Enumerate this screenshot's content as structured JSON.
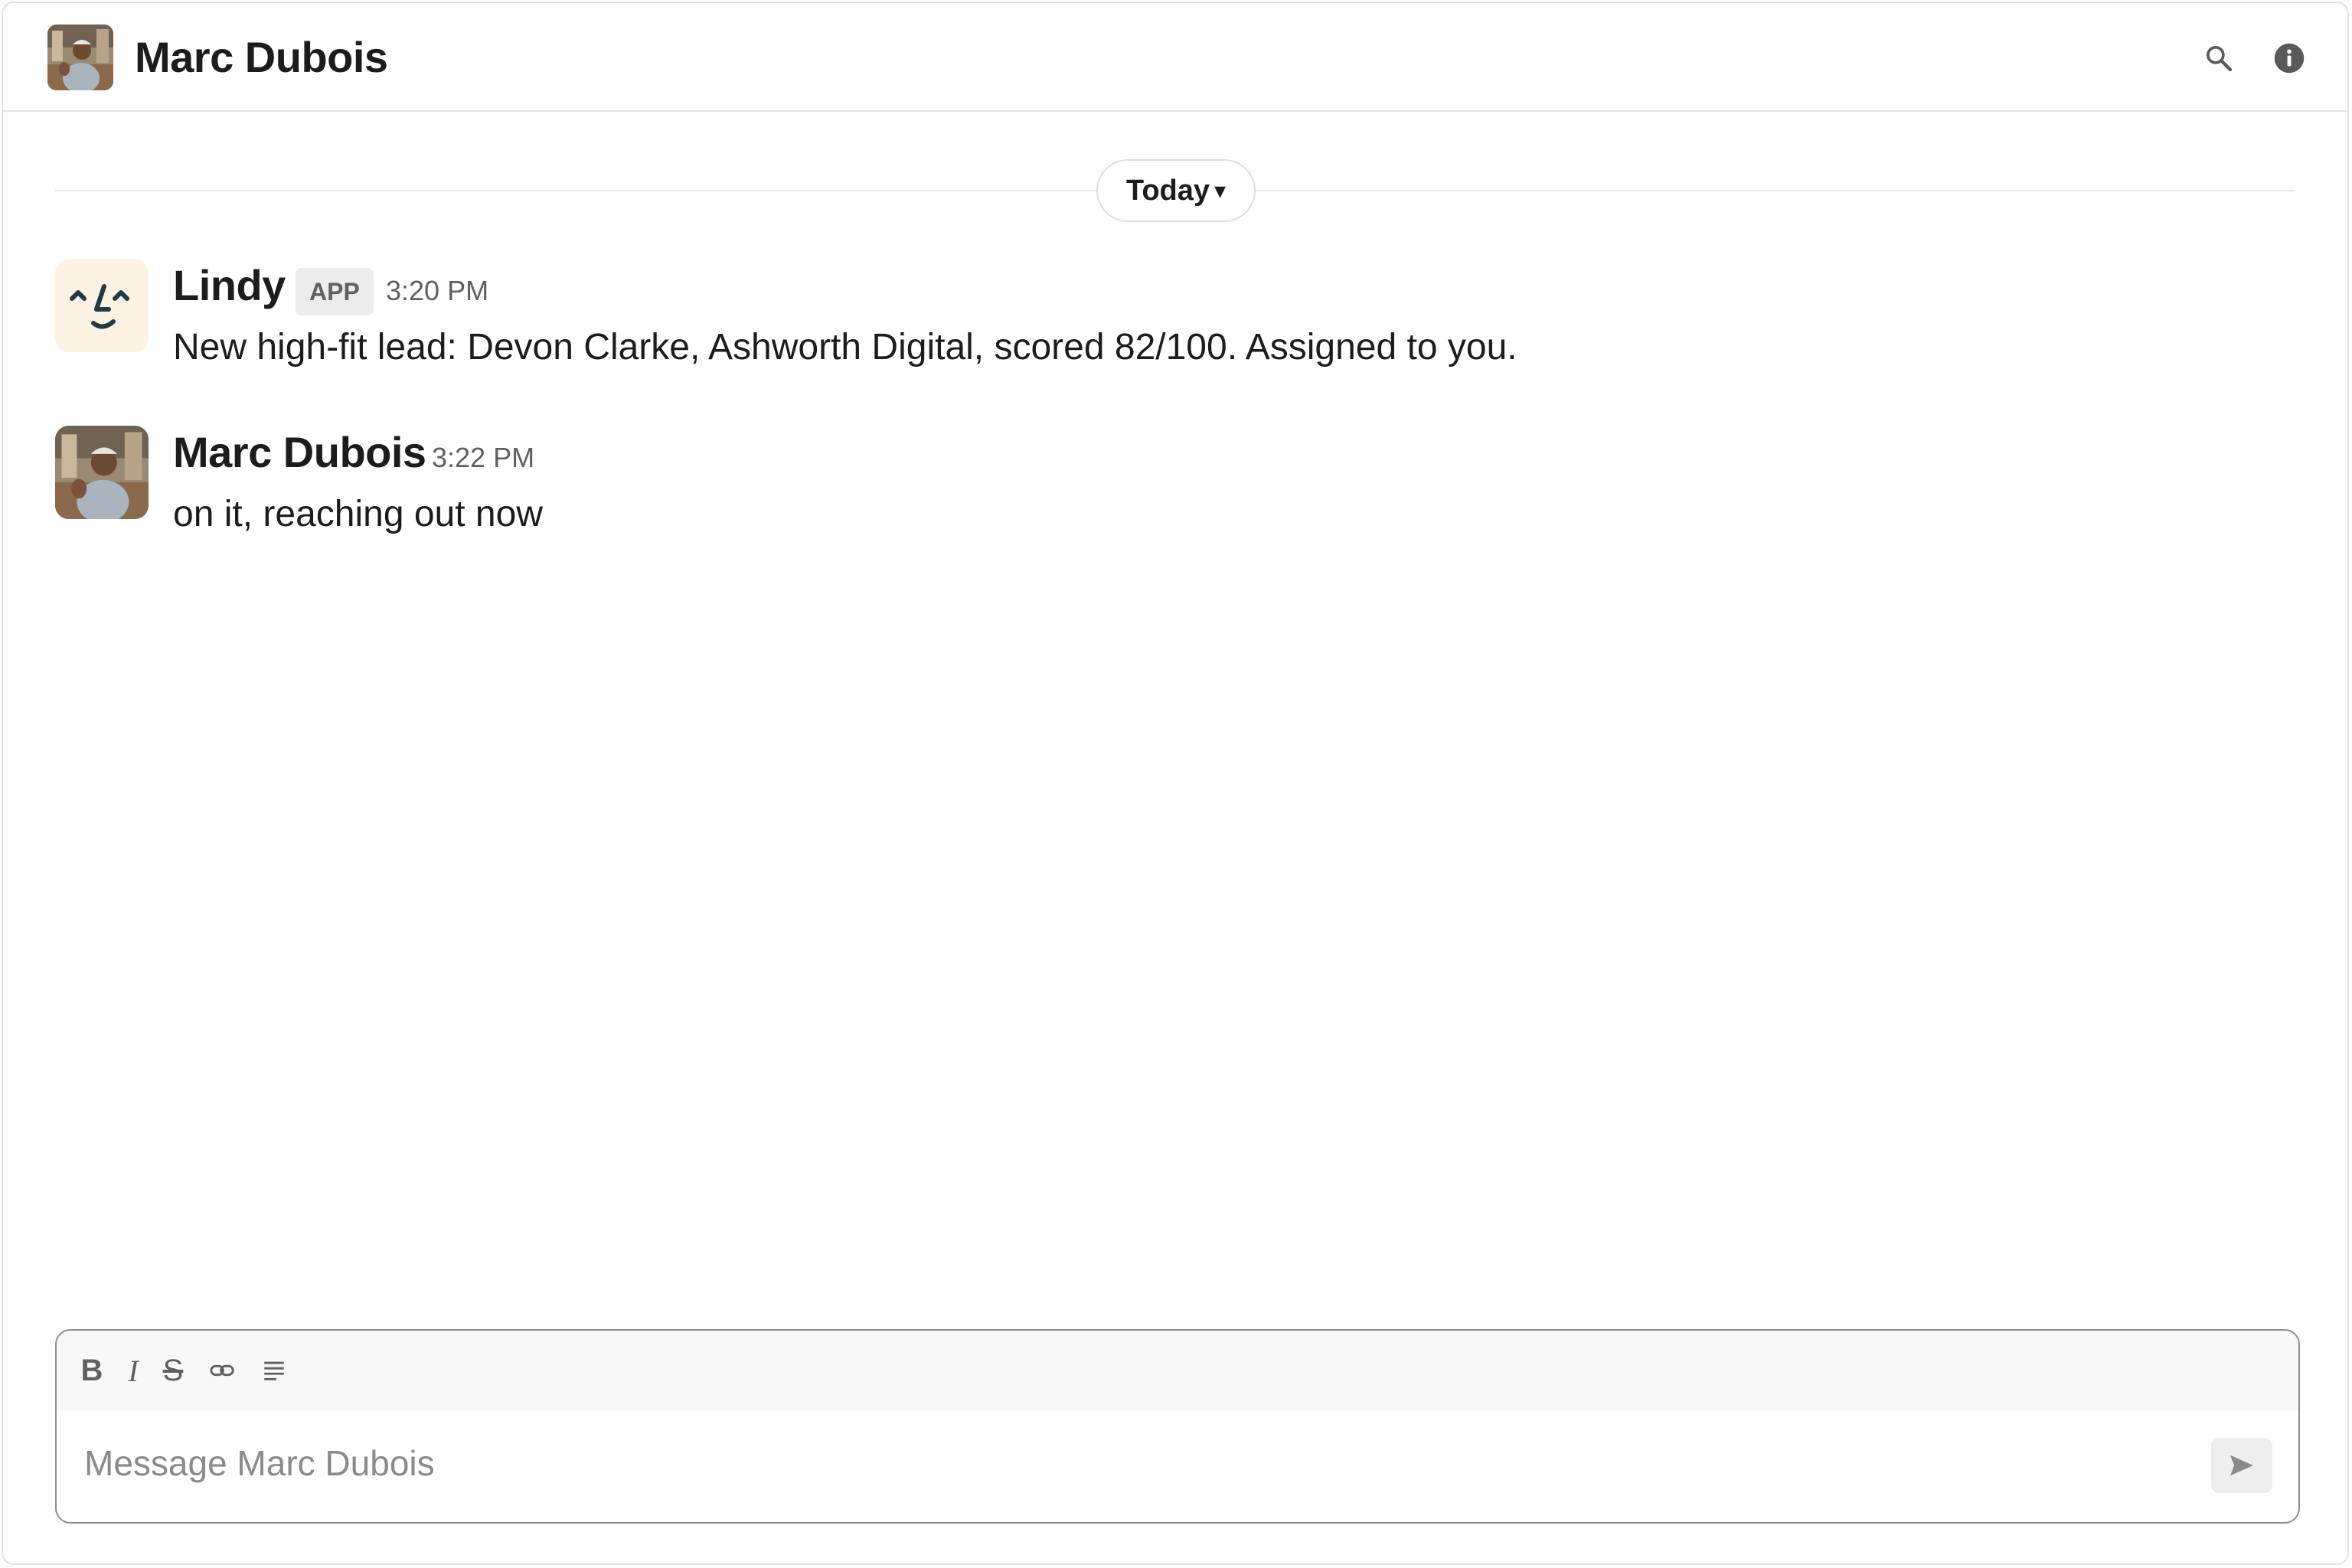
{
  "header": {
    "title": "Marc Dubois",
    "avatar_icon": "user-photo-avatar",
    "search_icon": "search-icon",
    "info_icon": "info-icon"
  },
  "date_divider": {
    "label": "Today"
  },
  "messages": [
    {
      "sender": "Lindy",
      "badge": "APP",
      "time": "3:20 PM",
      "text": "New high-fit lead: Devon Clarke, Ashworth Digital, scored 82/100. Assigned to you.",
      "avatar_icon": "lindy-face-logo"
    },
    {
      "sender": "Marc Dubois",
      "time": "3:22 PM",
      "text": "on it, reaching out now",
      "avatar_icon": "user-photo-avatar"
    }
  ],
  "composer": {
    "placeholder": "Message Marc Dubois",
    "value": "",
    "tools": {
      "bold": "B",
      "italic": "I",
      "strike": "S"
    }
  },
  "colors": {
    "text": "#1d1c1d",
    "muted": "#616061",
    "divider": "#e5e5e5",
    "lindy_bg": "#fdf3e3",
    "lindy_ink": "#1f3b46"
  }
}
